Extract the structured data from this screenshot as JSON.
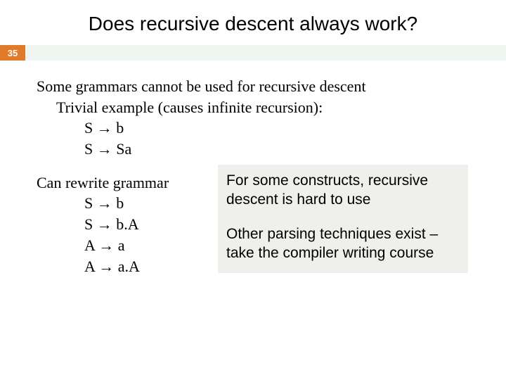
{
  "slide": {
    "title": "Does recursive descent always work?",
    "number": "35"
  },
  "body": {
    "line1": "Some grammars cannot be used for recursive descent",
    "line2": "Trivial example (causes infinite recursion):",
    "rule1_lhs": "S",
    "rule1_rhs": "b",
    "rule2_lhs": "S",
    "rule2_rhs": "Sa",
    "line3": "Can rewrite grammar",
    "rule3_lhs": "S",
    "rule3_rhs": "b",
    "rule4_lhs": "S",
    "rule4_rhs": "b.A",
    "rule5_lhs": "A",
    "rule5_rhs": "a",
    "rule6_lhs": "A",
    "rule6_rhs": "a.A",
    "arrow": "→"
  },
  "callout": {
    "p1": "For some constructs, recursive descent is hard to use",
    "p2": "Other parsing techniques exist – take the compiler writing course"
  }
}
